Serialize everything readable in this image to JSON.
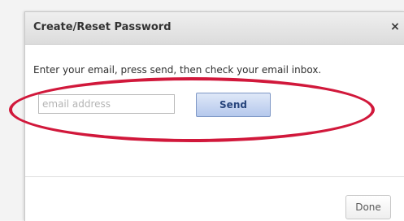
{
  "dialog": {
    "title": "Create/Reset Password",
    "close_icon": "close-icon",
    "close_glyph": "×",
    "instructions": "Enter your email, press send, then check your email inbox.",
    "email_placeholder": "email address",
    "email_value": "",
    "send_label": "Send",
    "done_label": "Done"
  },
  "annotation": {
    "color": "#d1183b",
    "shape": "ellipse"
  },
  "colors": {
    "send_button": "#b5c8ec",
    "send_text": "#27457c"
  }
}
